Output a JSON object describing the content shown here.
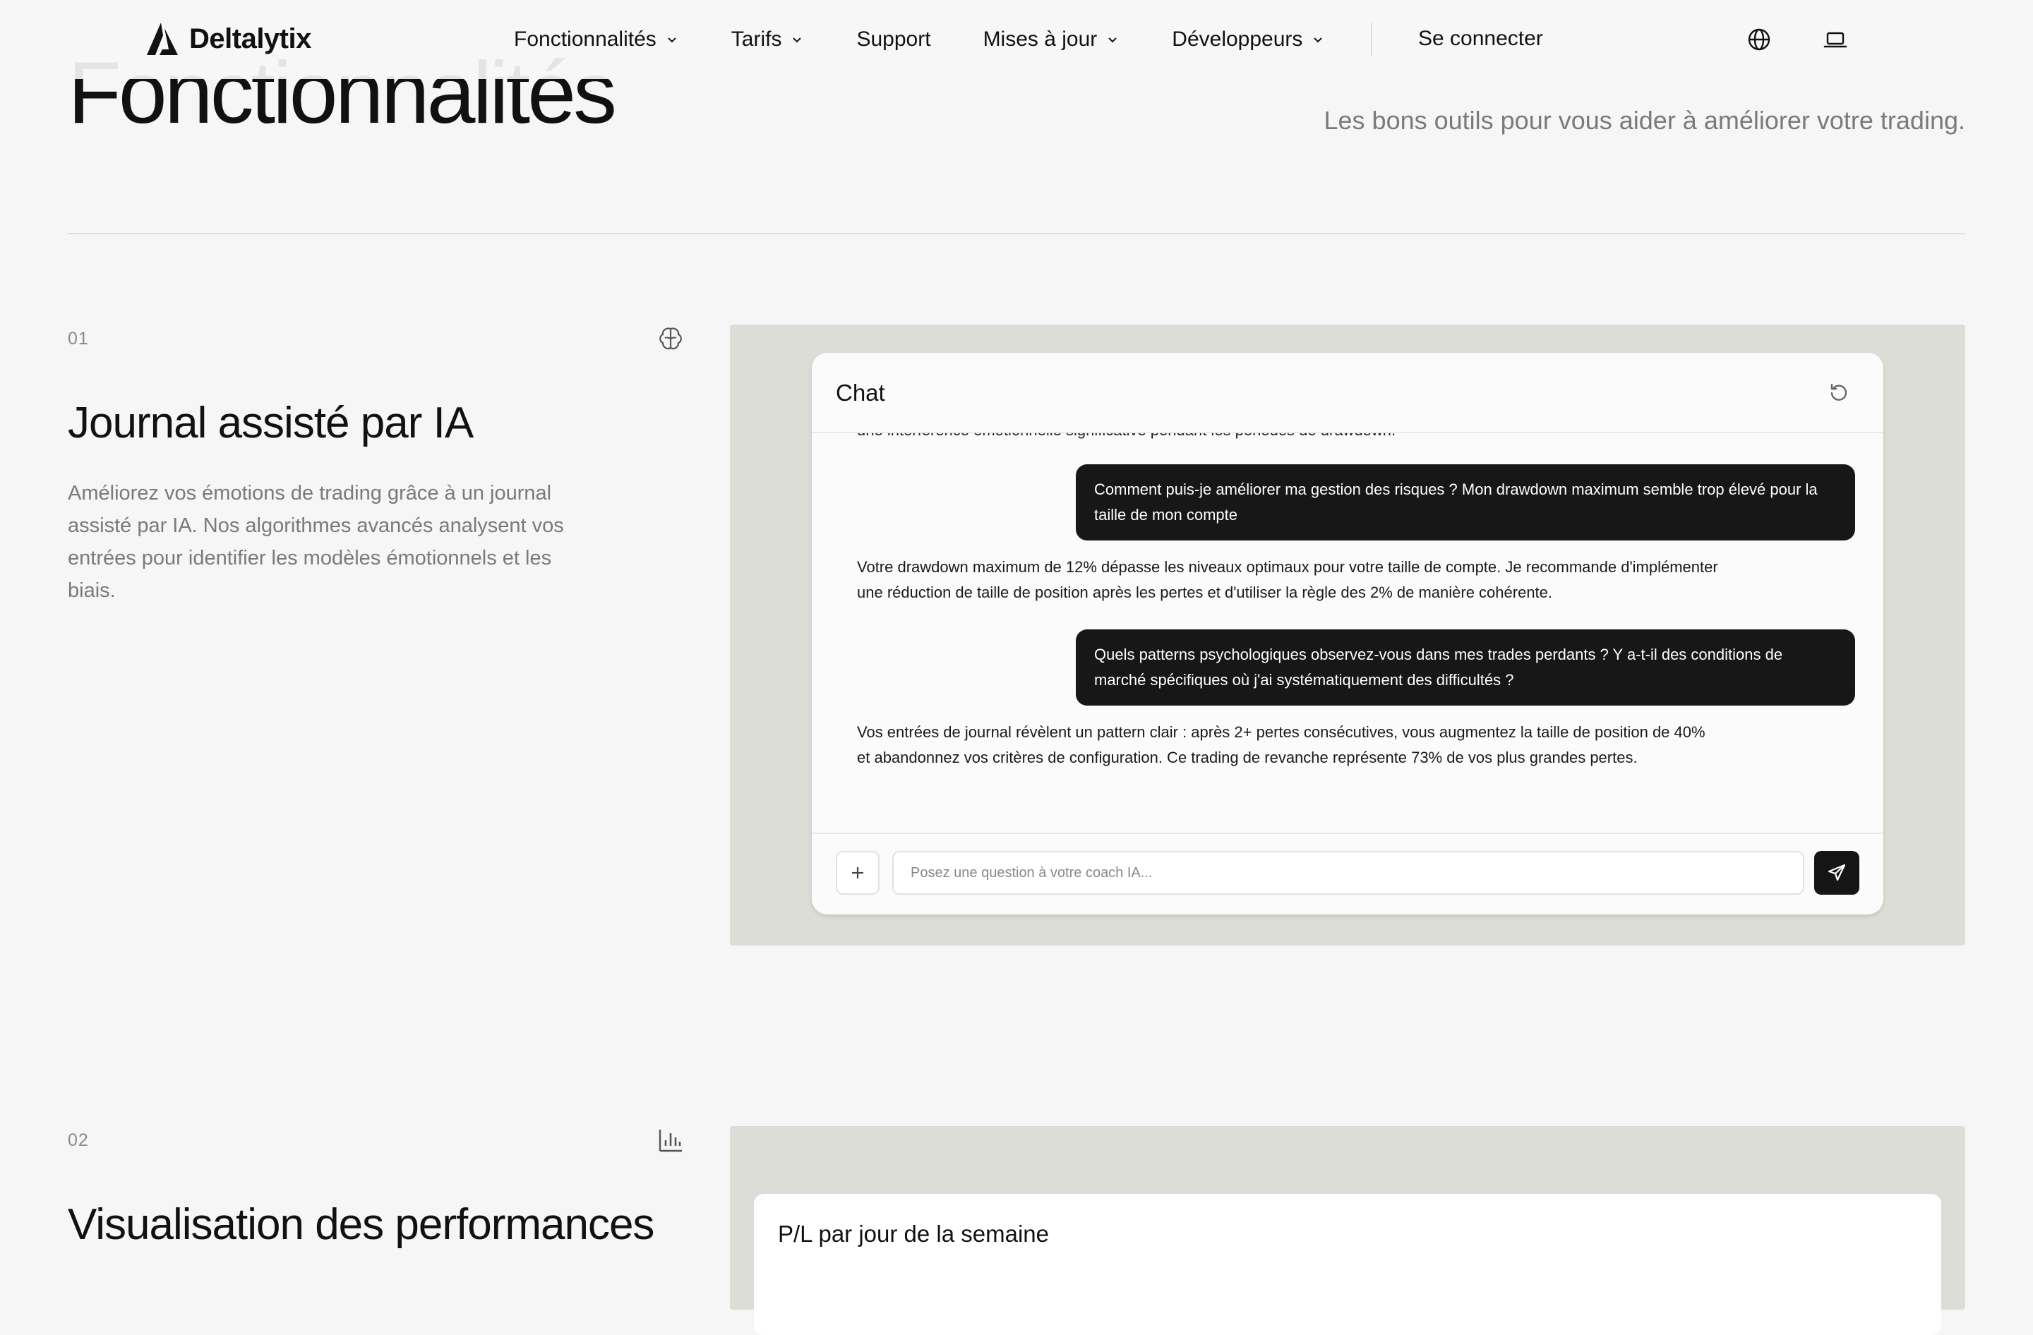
{
  "nav": {
    "logo_text": "Deltalytix",
    "items": [
      {
        "label": "Fonctionnalités",
        "has_dropdown": true
      },
      {
        "label": "Tarifs",
        "has_dropdown": true
      },
      {
        "label": "Support",
        "has_dropdown": false
      },
      {
        "label": "Mises à jour",
        "has_dropdown": true
      },
      {
        "label": "Développeurs",
        "has_dropdown": true
      }
    ],
    "login_label": "Se connecter",
    "icons": [
      "globe-icon",
      "laptop-icon"
    ]
  },
  "hero": {
    "title": "Fonctionnalités",
    "subtitle": "Les bons outils pour vous aider à améliorer votre trading."
  },
  "features": [
    {
      "number": "01",
      "icon": "brain-icon",
      "title": "Journal assisté par IA",
      "description": "Améliorez vos émotions de trading grâce à un journal assisté par IA. Nos algorithmes avancés analysent vos entrées pour identifier les modèles émotionnels et les biais."
    },
    {
      "number": "02",
      "icon": "bar-chart-icon",
      "title": "Visualisation des performances",
      "description": ""
    }
  ],
  "chat": {
    "title": "Chat",
    "messages": [
      {
        "role": "ai",
        "text": "une interférence émotionnelle significative pendant les périodes de drawdown."
      },
      {
        "role": "user",
        "text": "Comment puis-je améliorer ma gestion des risques ? Mon drawdown maximum semble trop élevé pour la taille de mon compte"
      },
      {
        "role": "ai",
        "text": "Votre drawdown maximum de 12% dépasse les niveaux optimaux pour votre taille de compte. Je recommande d'implémenter une réduction de taille de position après les pertes et d'utiliser la règle des 2% de manière cohérente."
      },
      {
        "role": "user",
        "text": "Quels patterns psychologiques observez-vous dans mes trades perdants ? Y a-t-il des conditions de marché spécifiques où j'ai systématiquement des difficultés ?"
      },
      {
        "role": "ai",
        "text": "Vos entrées de journal révèlent un pattern clair : après 2+ pertes consécutives, vous augmentez la taille de position de 40% et abandonnez vos critères de configuration. Ce trading de revanche représente 73% de vos plus grandes pertes."
      }
    ],
    "input_placeholder": "Posez une question à votre coach IA..."
  },
  "pl_card": {
    "title": "P/L par jour de la semaine"
  },
  "colors": {
    "background": "#f6f6f6",
    "panel": "#dcddd6",
    "user_bubble": "#171717",
    "muted_text": "#7a7a7a"
  }
}
